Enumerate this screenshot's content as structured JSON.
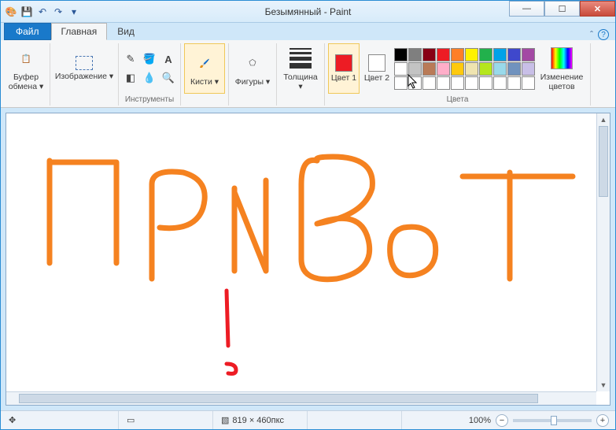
{
  "title": "Безымянный - Paint",
  "qat": {
    "save": "💾",
    "undo": "↶",
    "redo": "↷"
  },
  "tabs": {
    "file": "Файл",
    "home": "Главная",
    "view": "Вид"
  },
  "ribbon": {
    "clipboard": {
      "label": "Буфер обмена ▾",
      "group": ""
    },
    "image": {
      "label": "Изображение ▾"
    },
    "tools_group": "Инструменты",
    "brushes": {
      "label": "Кисти ▾"
    },
    "shapes": {
      "label": "Фигуры ▾"
    },
    "size": {
      "label": "Толщина ▾"
    },
    "color1": "Цвет 1",
    "color2": "Цвет 2",
    "colors_group": "Цвета",
    "editcolors": "Изменение цветов"
  },
  "palette_row1": [
    "#000000",
    "#7f7f7f",
    "#880015",
    "#ed1c24",
    "#ff7f27",
    "#fff200",
    "#22b14c",
    "#00a2e8",
    "#3f48cc",
    "#a349a4"
  ],
  "palette_row2": [
    "#ffffff",
    "#c3c3c3",
    "#b97a57",
    "#ffaec9",
    "#ffc90e",
    "#efe4b0",
    "#b5e61d",
    "#99d9ea",
    "#7092be",
    "#c8bfe7"
  ],
  "palette_row3": [
    "#ffffff",
    "#ffffff",
    "#ffffff",
    "#ffffff",
    "#ffffff",
    "#ffffff",
    "#ffffff",
    "#ffffff",
    "#ffffff",
    "#ffffff"
  ],
  "color1_value": "#ed1c24",
  "color2_value": "#ffffff",
  "status": {
    "dims": "819 × 460пкс",
    "zoom": "100%"
  }
}
